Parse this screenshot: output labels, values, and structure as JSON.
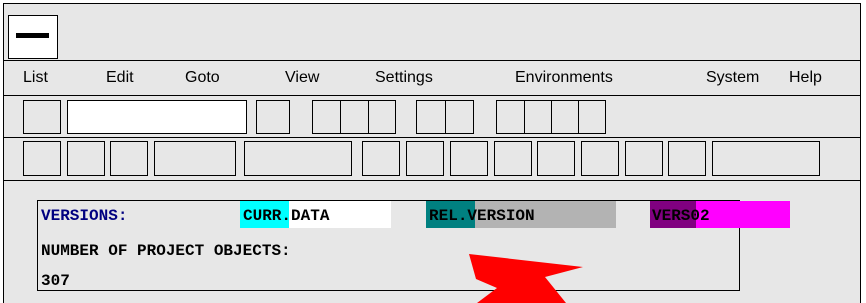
{
  "menu": [
    "List",
    "Edit",
    "Goto",
    "View",
    "Settings",
    "Environments",
    "System",
    "Help"
  ],
  "versions_label": "VERSIONS:",
  "curr": {
    "prefix": "CURR",
    "suffix": ".DATA"
  },
  "rel": {
    "prefix": "REL",
    "suffix": ".VERSION"
  },
  "vers": {
    "prefix": "VERS",
    "suffix": "02"
  },
  "objects_label": "NUMBER OF PROJECT OBJECTS:",
  "objects_count": "307",
  "colors": {
    "curr_highlight": "#00ffff",
    "rel_highlight": "#008080",
    "rel_rest": "#b3b3b3",
    "vers_highlight": "#800080",
    "vers_rest": "#ff00ff",
    "label_blue": "#000080",
    "arrow": "#ff0000"
  }
}
